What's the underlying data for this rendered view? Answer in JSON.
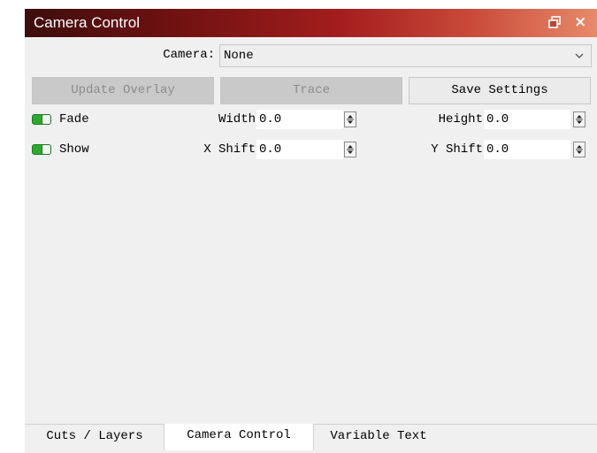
{
  "window": {
    "title": "Camera Control",
    "title_gradient_colors": [
      "#3e0d0d",
      "#a31d1d",
      "#e88a6a"
    ],
    "icons": [
      "float-icon",
      "close-icon"
    ],
    "close_glyph": "×"
  },
  "camera": {
    "label": "Camera:",
    "selected": "None"
  },
  "buttons": {
    "update_overlay": "Update Overlay",
    "trace": "Trace",
    "save_settings": "Save Settings"
  },
  "row1": {
    "toggle_label": "Fade",
    "toggle_on": true,
    "field1_label": "Width",
    "field1_value": "0.0",
    "field2_label": "Height",
    "field2_value": "0.0"
  },
  "row2": {
    "toggle_label": "Show",
    "toggle_on": true,
    "field1_label": "X Shift",
    "field1_value": "0.0",
    "field2_label": "Y Shift",
    "field2_value": "0.0"
  },
  "tabs": [
    {
      "label": "Cuts / Layers",
      "active": false
    },
    {
      "label": "Camera Control",
      "active": true
    },
    {
      "label": "Variable Text",
      "active": false
    }
  ],
  "colors": {
    "toggle_green": "#2eaa2e",
    "panel_bg": "#f0f0f0",
    "disabled_button": "#c9c9c9"
  }
}
